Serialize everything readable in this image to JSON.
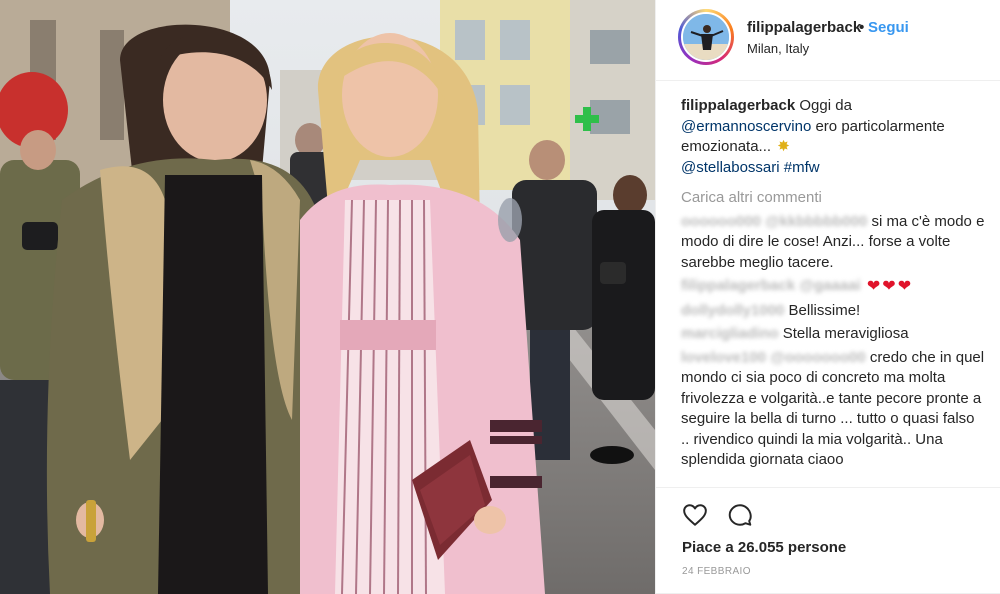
{
  "post": {
    "username": "filippalagerback",
    "follow_label": "Segui",
    "separator": "•",
    "location": "Milan, Italy",
    "caption": {
      "username": "filippalagerback",
      "text_1": "Oggi da",
      "mention_1": "@ermannoscervino",
      "text_2": "ero particolarmente emozionata...",
      "mention_2": "@stellabossari",
      "hashtag": "#mfw"
    },
    "load_more_label": "Carica altri commenti",
    "comments": [
      {
        "username": "oooooo000 @kkbbbbb000",
        "text": "si ma c'è modo e modo di dire le cose! Anzi... forse a volte sarebbe meglio tacere."
      },
      {
        "username": "filippalagerback @gaaaai",
        "text": ""
      },
      {
        "username": "dollydolly1000",
        "text": "Bellissime!"
      },
      {
        "username": "marcigliadino",
        "text": "Stella meravigliosa"
      },
      {
        "username": "lovelove100 @ooooooo00",
        "text": "credo che in quel mondo ci sia poco di concreto ma molta frivolezza e volgarità..e tante pecore pronte a seguire la bella di turno ... tutto o quasi falso .. rivendico quindi la mia volgarità.. Una splendida giornata ciaoo"
      }
    ],
    "likes_label": "Piace a 26.055 persone",
    "timestamp": "24 FEBBRAIO"
  },
  "icons": {
    "heart_emoji": "heart-emoji",
    "sparkle_emoji": "sparkle-emoji",
    "like": "heart-outline-icon",
    "comment": "comment-bubble-icon"
  },
  "colors": {
    "follow": "#3897f0",
    "mention": "#003569",
    "muted": "#999999",
    "heart": "#e0142b"
  }
}
